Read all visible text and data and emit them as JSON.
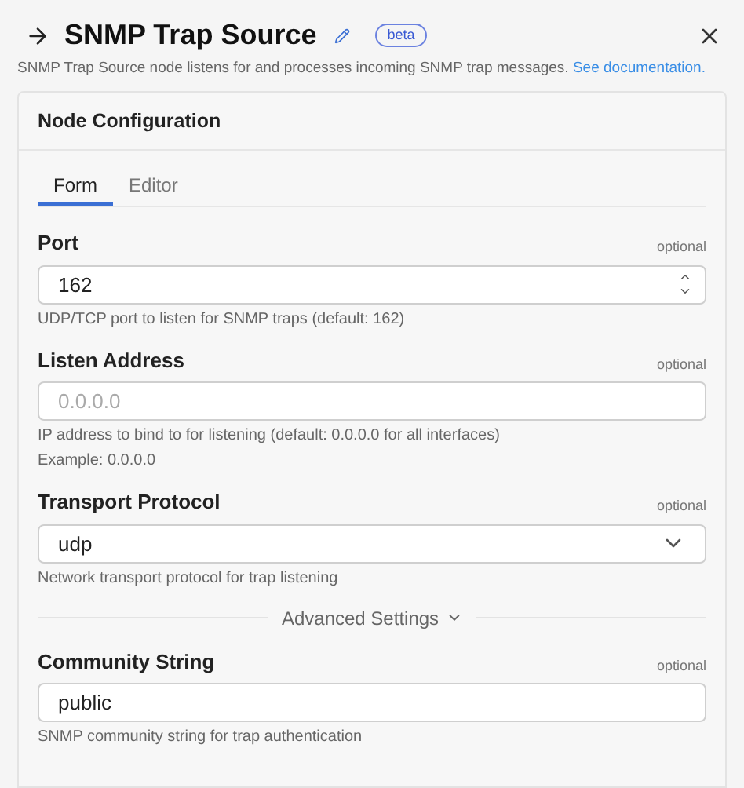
{
  "header": {
    "title": "SNMP Trap Source",
    "badge": "beta",
    "description": "SNMP Trap Source node listens for and processes incoming SNMP trap messages.",
    "doc_link": "See documentation."
  },
  "card": {
    "title": "Node Configuration",
    "tabs": [
      {
        "label": "Form",
        "selected": true
      },
      {
        "label": "Editor",
        "selected": false
      }
    ],
    "fields": [
      {
        "kind": "number",
        "label": "Port",
        "optional": "optional",
        "value": "162",
        "help": [
          "UDP/TCP port to listen for SNMP traps (default: 162)"
        ]
      },
      {
        "kind": "text",
        "label": "Listen Address",
        "optional": "optional",
        "placeholder": "0.0.0.0",
        "help": [
          "IP address to bind to for listening (default: 0.0.0.0 for all interfaces)",
          "Example: 0.0.0.0"
        ]
      },
      {
        "kind": "select",
        "label": "Transport Protocol",
        "optional": "optional",
        "value": "udp",
        "help": [
          "Network transport protocol for trap listening"
        ]
      }
    ],
    "advanced": {
      "label": "Advanced Settings",
      "expanded": true
    },
    "advanced_fields": [
      {
        "kind": "text",
        "label": "Community String",
        "optional": "optional",
        "value": "public",
        "help": [
          "SNMP community string for trap authentication"
        ]
      }
    ]
  }
}
